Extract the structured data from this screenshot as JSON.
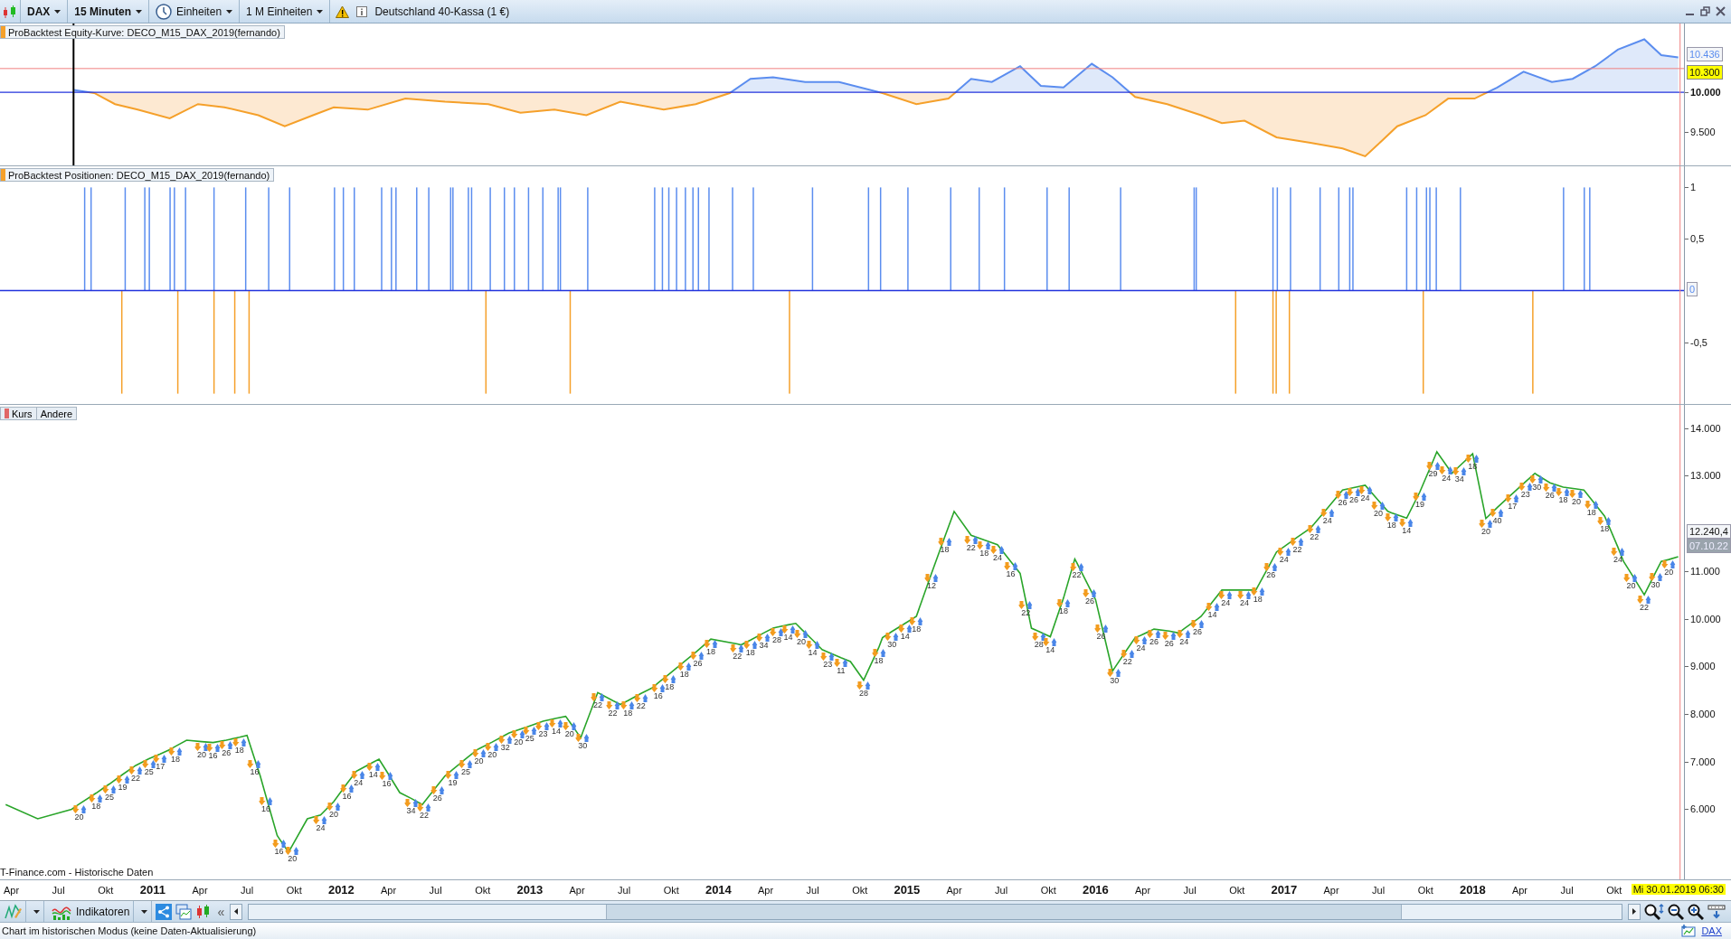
{
  "toolbar": {
    "symbol": "DAX",
    "timeframe": "15 Minuten",
    "units": "Einheiten",
    "units_count": "1 M Einheiten",
    "instrument": "Deutschland 40-Kassa (1 €)"
  },
  "equity_panel": {
    "legend": "ProBacktest Equity-Kurve: DECO_M15_DAX_2019(fernando)",
    "value_label": "10.436",
    "chart_data": {
      "type": "area",
      "xlim": [
        2010.19,
        2019.37
      ],
      "ylim": [
        9075,
        10870
      ],
      "yticks": [
        {
          "value": 10000,
          "label": "10.000"
        },
        {
          "value": 9500,
          "label": "9.500"
        }
      ],
      "x": [
        2010.58,
        2010.69,
        2010.8,
        2010.92,
        2011.09,
        2011.24,
        2011.38,
        2011.56,
        2011.7,
        2011.85,
        2011.96,
        2012.14,
        2012.34,
        2012.55,
        2012.78,
        2012.95,
        2013.13,
        2013.3,
        2013.48,
        2013.71,
        2013.88,
        2014.06,
        2014.17,
        2014.29,
        2014.46,
        2014.64,
        2014.87,
        2015.05,
        2015.22,
        2015.34,
        2015.45,
        2015.6,
        2015.71,
        2015.83,
        2015.98,
        2016.09,
        2016.21,
        2016.38,
        2016.56,
        2016.67,
        2016.79,
        2016.96,
        2017.14,
        2017.31,
        2017.43,
        2017.52,
        2017.6,
        2017.75,
        2017.87,
        2018.01,
        2018.13,
        2018.27,
        2018.42,
        2018.53,
        2018.65,
        2018.77,
        2018.91,
        2019.0,
        2019.09
      ],
      "series": [
        {
          "color": "#5b8def",
          "values": [
            10030,
            9990,
            9850,
            9780,
            9670,
            9850,
            9810,
            9710,
            9570,
            9710,
            9810,
            9780,
            9920,
            9880,
            9850,
            9740,
            9780,
            9710,
            9880,
            9780,
            9850,
            9990,
            10170,
            10190,
            10130,
            10130,
            9990,
            9850,
            9920,
            10170,
            10130,
            10330,
            10080,
            10060,
            10360,
            10190,
            9940,
            9850,
            9710,
            9610,
            9640,
            9430,
            9360,
            9290,
            9190,
            9390,
            9570,
            9710,
            9920,
            9920,
            10060,
            10260,
            10130,
            10170,
            10330,
            10540,
            10670,
            10470,
            10440
          ]
        }
      ],
      "ref_lines": [
        {
          "axis": "y",
          "value": 10000,
          "color": "#2233dd"
        },
        {
          "axis": "y",
          "value": 10300,
          "color": "#f08080",
          "label": "10.300"
        },
        {
          "axis": "x",
          "value": 2010.58,
          "color": "#000000"
        },
        {
          "axis": "x",
          "value": 2019.1,
          "color": "#f08080"
        }
      ]
    }
  },
  "positions_panel": {
    "legend": "ProBacktest Positionen: DECO_M15_DAX_2019(fernando)",
    "chart_data": {
      "type": "bar",
      "xlim": [
        2010.19,
        2019.37
      ],
      "ylim": [
        -1.1,
        1.205
      ],
      "yticks": [
        {
          "value": 1,
          "label": "1"
        },
        {
          "value": 0.5,
          "label": "0,5"
        },
        {
          "value": -0.5,
          "label": "-0,5"
        }
      ],
      "x": [
        2010.639,
        2010.673,
        2010.836,
        2010.854,
        2010.958,
        2010.982,
        2011.092,
        2011.115,
        2011.133,
        2011.174,
        2011.325,
        2011.435,
        2011.493,
        2011.511,
        2011.615,
        2011.726,
        2011.964,
        2012.011,
        2012.069,
        2012.214,
        2012.266,
        2012.29,
        2012.4,
        2012.464,
        2012.58,
        2012.592,
        2012.674,
        2012.691,
        2012.767,
        2012.79,
        2012.865,
        2012.918,
        2012.993,
        2013.069,
        2013.15,
        2013.162,
        2013.214,
        2013.307,
        2013.662,
        2013.703,
        2013.737,
        2013.778,
        2013.825,
        2013.865,
        2013.894,
        2013.95,
        2014.075,
        2014.185,
        2014.377,
        2014.499,
        2014.796,
        2014.86,
        2015.005,
        2015.232,
        2015.383,
        2015.517,
        2015.743,
        2015.86,
        2016.133,
        2016.523,
        2016.534,
        2016.743,
        2016.941,
        2016.958,
        2016.964,
        2017.028,
        2017.034,
        2017.191,
        2017.29,
        2017.348,
        2017.365,
        2017.65,
        2017.703,
        2017.738,
        2017.755,
        2017.773,
        2017.807,
        2017.935,
        2018.319,
        2018.482,
        2018.592,
        2018.621
      ],
      "series": [
        {
          "color": "#5b8def",
          "values": [
            1,
            1,
            null,
            1,
            1,
            1,
            1,
            1,
            null,
            1,
            1,
            null,
            1,
            null,
            1,
            1,
            1,
            1,
            1,
            1,
            1,
            1,
            1,
            1,
            1,
            1,
            1,
            1,
            null,
            1,
            1,
            1,
            1,
            1,
            1,
            1,
            null,
            1,
            1,
            1,
            1,
            1,
            1,
            1,
            1,
            1,
            1,
            1,
            null,
            1,
            1,
            1,
            1,
            1,
            1,
            1,
            1,
            1,
            1,
            1,
            1,
            null,
            1,
            null,
            1,
            null,
            1,
            1,
            1,
            1,
            1,
            1,
            1,
            null,
            1,
            1,
            1,
            1,
            null,
            1,
            1,
            1
          ]
        },
        {
          "color": "#f5a02a",
          "values": [
            null,
            null,
            -1,
            null,
            null,
            null,
            null,
            null,
            -1,
            null,
            -1,
            -1,
            null,
            -1,
            null,
            null,
            null,
            null,
            null,
            null,
            null,
            null,
            null,
            null,
            null,
            null,
            null,
            null,
            -1,
            null,
            null,
            null,
            null,
            null,
            null,
            null,
            -1,
            null,
            null,
            null,
            null,
            null,
            null,
            null,
            null,
            null,
            null,
            null,
            -1,
            null,
            null,
            null,
            null,
            null,
            null,
            null,
            null,
            null,
            null,
            null,
            null,
            -1,
            -1,
            -1,
            null,
            -1,
            null,
            null,
            null,
            null,
            null,
            null,
            null,
            -1,
            null,
            null,
            null,
            null,
            -1,
            null,
            null,
            null
          ]
        }
      ],
      "ref_lines": [
        {
          "axis": "y",
          "value": 0,
          "color": "#2233dd",
          "label": "0"
        },
        {
          "axis": "x",
          "value": 2019.1,
          "color": "#f08080"
        }
      ]
    }
  },
  "price_panel": {
    "tabs": [
      {
        "label": "Kurs",
        "color": "#e06666"
      },
      {
        "label": "Andere"
      }
    ],
    "source": "T-Finance.com - Historische Daten",
    "value_label": "12.240,4",
    "countdown": "07.10.22",
    "cursor_label": "Mi 30.01.2019 06:30",
    "chart_data": {
      "type": "line",
      "xlim": [
        2010.19,
        2019.37
      ],
      "ylim": [
        4530,
        14485
      ],
      "yticks": [
        {
          "value": 14000,
          "label": "14.000"
        },
        {
          "value": 13000,
          "label": "13.000"
        },
        {
          "value": 11000,
          "label": "11.000"
        },
        {
          "value": 10000,
          "label": "10.000"
        },
        {
          "value": 9000,
          "label": "9.000"
        },
        {
          "value": 8000,
          "label": "8.000"
        },
        {
          "value": 7000,
          "label": "7.000"
        },
        {
          "value": 6000,
          "label": "6.000"
        }
      ],
      "xticks": [
        {
          "value": 2010.25,
          "label": "Apr"
        },
        {
          "value": 2010.5,
          "label": "Jul"
        },
        {
          "value": 2010.75,
          "label": "Okt"
        },
        {
          "value": 2011,
          "label": "2011"
        },
        {
          "value": 2011.25,
          "label": "Apr"
        },
        {
          "value": 2011.5,
          "label": "Jul"
        },
        {
          "value": 2011.75,
          "label": "Okt"
        },
        {
          "value": 2012,
          "label": "2012"
        },
        {
          "value": 2012.25,
          "label": "Apr"
        },
        {
          "value": 2012.5,
          "label": "Jul"
        },
        {
          "value": 2012.75,
          "label": "Okt"
        },
        {
          "value": 2013,
          "label": "2013"
        },
        {
          "value": 2013.25,
          "label": "Apr"
        },
        {
          "value": 2013.5,
          "label": "Jul"
        },
        {
          "value": 2013.75,
          "label": "Okt"
        },
        {
          "value": 2014,
          "label": "2014"
        },
        {
          "value": 2014.25,
          "label": "Apr"
        },
        {
          "value": 2014.5,
          "label": "Jul"
        },
        {
          "value": 2014.75,
          "label": "Okt"
        },
        {
          "value": 2015,
          "label": "2015"
        },
        {
          "value": 2015.25,
          "label": "Apr"
        },
        {
          "value": 2015.5,
          "label": "Jul"
        },
        {
          "value": 2015.75,
          "label": "Okt"
        },
        {
          "value": 2016,
          "label": "2016"
        },
        {
          "value": 2016.25,
          "label": "Apr"
        },
        {
          "value": 2016.5,
          "label": "Jul"
        },
        {
          "value": 2016.75,
          "label": "Okt"
        },
        {
          "value": 2017,
          "label": "2017"
        },
        {
          "value": 2017.25,
          "label": "Apr"
        },
        {
          "value": 2017.5,
          "label": "Jul"
        },
        {
          "value": 2017.75,
          "label": "Okt"
        },
        {
          "value": 2018,
          "label": "2018"
        },
        {
          "value": 2018.25,
          "label": "Apr"
        },
        {
          "value": 2018.5,
          "label": "Jul"
        },
        {
          "value": 2018.75,
          "label": "Okt"
        }
      ],
      "x": [
        2010.22,
        2010.39,
        2010.57,
        2010.61,
        2010.7,
        2010.74,
        2010.77,
        2010.84,
        2010.91,
        2010.98,
        2011.04,
        2011.09,
        2011.12,
        2011.18,
        2011.26,
        2011.32,
        2011.39,
        2011.46,
        2011.5,
        2011.54,
        2011.57,
        2011.6,
        2011.66,
        2011.67,
        2011.72,
        2011.74,
        2011.82,
        2011.89,
        2011.96,
        2012.03,
        2012.08,
        2012.09,
        2012.17,
        2012.2,
        2012.24,
        2012.31,
        2012.37,
        2012.43,
        2012.44,
        2012.51,
        2012.55,
        2012.59,
        2012.66,
        2012.72,
        2012.73,
        2012.8,
        2012.87,
        2012.89,
        2012.94,
        2013.0,
        2013.07,
        2013.14,
        2013.19,
        2013.21,
        2013.27,
        2013.28,
        2013.36,
        2013.44,
        2013.48,
        2013.52,
        2013.59,
        2013.65,
        2013.68,
        2013.74,
        2013.82,
        2013.89,
        2013.96,
        2014.1,
        2014.12,
        2014.17,
        2014.24,
        2014.29,
        2014.31,
        2014.37,
        2014.41,
        2014.44,
        2014.5,
        2014.55,
        2014.58,
        2014.65,
        2014.7,
        2014.77,
        2014.85,
        2014.87,
        2014.92,
        2014.99,
        2015.05,
        2015.13,
        2015.2,
        2015.25,
        2015.34,
        2015.41,
        2015.48,
        2015.55,
        2015.6,
        2015.63,
        2015.66,
        2015.7,
        2015.76,
        2015.83,
        2015.89,
        2015.9,
        2015.97,
        2016.0,
        2016.03,
        2016.09,
        2016.1,
        2016.17,
        2016.21,
        2016.24,
        2016.31,
        2016.39,
        2016.44,
        2016.47,
        2016.54,
        2016.56,
        2016.62,
        2016.67,
        2016.69,
        2016.79,
        2016.85,
        2016.86,
        2016.93,
        2016.96,
        2017.0,
        2017.07,
        2017.14,
        2017.16,
        2017.23,
        2017.31,
        2017.37,
        2017.43,
        2017.5,
        2017.55,
        2017.57,
        2017.65,
        2017.72,
        2017.79,
        2017.81,
        2017.86,
        2017.89,
        2017.93,
        2018.0,
        2018.07,
        2018.13,
        2018.19,
        2018.21,
        2018.28,
        2018.33,
        2018.34,
        2018.41,
        2018.48,
        2018.55,
        2018.59,
        2018.63,
        2018.7,
        2018.77,
        2018.8,
        2018.84,
        2018.91,
        2018.97,
        2019.0,
        2019.04,
        2019.09
      ],
      "series": [
        {
          "color": "#2aa52a",
          "values": [
            6100,
            5800,
            6000,
            6110,
            6340,
            6450,
            6530,
            6730,
            6920,
            7060,
            7160,
            7250,
            7320,
            7450,
            7420,
            7400,
            7450,
            7510,
            7550,
            7060,
            6700,
            6280,
            5450,
            5390,
            5100,
            5240,
            5800,
            5880,
            6160,
            6540,
            6800,
            6820,
            6990,
            7050,
            6800,
            6350,
            6230,
            6100,
            6150,
            6500,
            6700,
            6830,
            7060,
            7250,
            7270,
            7410,
            7560,
            7600,
            7670,
            7750,
            7850,
            7910,
            7950,
            7840,
            7500,
            7610,
            8450,
            8280,
            8200,
            8280,
            8430,
            8550,
            8650,
            8840,
            9100,
            9330,
            9570,
            9470,
            9450,
            9550,
            9700,
            9800,
            9820,
            9870,
            9900,
            9780,
            9550,
            9350,
            9300,
            9180,
            9100,
            8710,
            9390,
            9600,
            9730,
            9900,
            10050,
            10950,
            11710,
            12250,
            11750,
            11650,
            11550,
            11200,
            10950,
            10380,
            9800,
            9730,
            9620,
            10430,
            11250,
            11180,
            10630,
            10400,
            9900,
            8900,
            8960,
            9370,
            9600,
            9650,
            9780,
            9740,
            9700,
            9790,
            9990,
            10050,
            10350,
            10600,
            10600,
            10600,
            10600,
            10670,
            11180,
            11400,
            11510,
            11710,
            11900,
            11990,
            12320,
            12700,
            12750,
            12800,
            12480,
            12250,
            12220,
            12110,
            12660,
            13310,
            13500,
            13220,
            13050,
            13200,
            13460,
            12100,
            12330,
            12550,
            12620,
            12870,
            13050,
            13020,
            12850,
            12760,
            12720,
            12700,
            12500,
            12150,
            11500,
            11200,
            10950,
            10500,
            10970,
            11200,
            11240,
            11300
          ]
        }
      ],
      "ref_lines": [
        {
          "axis": "x",
          "value": 2019.1,
          "color": "#f08080"
        }
      ],
      "annotations": [
        {
          "x": 2010.61,
          "y": 6110,
          "text": "20"
        },
        {
          "x": 2010.7,
          "y": 6340,
          "text": "18"
        },
        {
          "x": 2010.77,
          "y": 6530,
          "text": "25"
        },
        {
          "x": 2010.84,
          "y": 6730,
          "text": "19"
        },
        {
          "x": 2010.91,
          "y": 6920,
          "text": "22"
        },
        {
          "x": 2010.98,
          "y": 7060,
          "text": "25"
        },
        {
          "x": 2011.04,
          "y": 7160,
          "text": "17"
        },
        {
          "x": 2011.12,
          "y": 7320,
          "text": "18"
        },
        {
          "x": 2011.26,
          "y": 7420,
          "text": "20"
        },
        {
          "x": 2011.32,
          "y": 7400,
          "text": "16"
        },
        {
          "x": 2011.39,
          "y": 7450,
          "text": "26"
        },
        {
          "x": 2011.46,
          "y": 7510,
          "text": "18"
        },
        {
          "x": 2011.54,
          "y": 7060,
          "text": "16"
        },
        {
          "x": 2011.6,
          "y": 6280,
          "text": "16"
        },
        {
          "x": 2011.67,
          "y": 5390,
          "text": "16"
        },
        {
          "x": 2011.74,
          "y": 5240,
          "text": "20"
        },
        {
          "x": 2011.89,
          "y": 5880,
          "text": "24"
        },
        {
          "x": 2011.96,
          "y": 6160,
          "text": "20"
        },
        {
          "x": 2012.03,
          "y": 6540,
          "text": "16"
        },
        {
          "x": 2012.09,
          "y": 6820,
          "text": "24"
        },
        {
          "x": 2012.17,
          "y": 6990,
          "text": "14"
        },
        {
          "x": 2012.24,
          "y": 6800,
          "text": "16"
        },
        {
          "x": 2012.37,
          "y": 6230,
          "text": "34"
        },
        {
          "x": 2012.44,
          "y": 6150,
          "text": "22"
        },
        {
          "x": 2012.51,
          "y": 6500,
          "text": "26"
        },
        {
          "x": 2012.59,
          "y": 6830,
          "text": "19"
        },
        {
          "x": 2012.66,
          "y": 7060,
          "text": "25"
        },
        {
          "x": 2012.73,
          "y": 7270,
          "text": "20"
        },
        {
          "x": 2012.8,
          "y": 7410,
          "text": "20"
        },
        {
          "x": 2012.87,
          "y": 7560,
          "text": "32"
        },
        {
          "x": 2012.94,
          "y": 7670,
          "text": "20"
        },
        {
          "x": 2013.0,
          "y": 7750,
          "text": "25"
        },
        {
          "x": 2013.07,
          "y": 7850,
          "text": "23"
        },
        {
          "x": 2013.14,
          "y": 7910,
          "text": "14"
        },
        {
          "x": 2013.21,
          "y": 7840,
          "text": "20"
        },
        {
          "x": 2013.28,
          "y": 7610,
          "text": "30"
        },
        {
          "x": 2013.36,
          "y": 8450,
          "text": "22"
        },
        {
          "x": 2013.44,
          "y": 8280,
          "text": "22"
        },
        {
          "x": 2013.52,
          "y": 8280,
          "text": "18"
        },
        {
          "x": 2013.59,
          "y": 8430,
          "text": "22"
        },
        {
          "x": 2013.68,
          "y": 8650,
          "text": "16"
        },
        {
          "x": 2013.74,
          "y": 8840,
          "text": "18"
        },
        {
          "x": 2013.82,
          "y": 9100,
          "text": "18"
        },
        {
          "x": 2013.89,
          "y": 9330,
          "text": "26"
        },
        {
          "x": 2013.96,
          "y": 9570,
          "text": "18"
        },
        {
          "x": 2014.1,
          "y": 9470,
          "text": "22"
        },
        {
          "x": 2014.17,
          "y": 9550,
          "text": "18"
        },
        {
          "x": 2014.24,
          "y": 9700,
          "text": "34"
        },
        {
          "x": 2014.31,
          "y": 9820,
          "text": "28"
        },
        {
          "x": 2014.37,
          "y": 9870,
          "text": "14"
        },
        {
          "x": 2014.44,
          "y": 9780,
          "text": "20"
        },
        {
          "x": 2014.5,
          "y": 9550,
          "text": "14"
        },
        {
          "x": 2014.58,
          "y": 9300,
          "text": "23"
        },
        {
          "x": 2014.65,
          "y": 9180,
          "text": "11"
        },
        {
          "x": 2014.77,
          "y": 8710,
          "text": "28"
        },
        {
          "x": 2014.85,
          "y": 9390,
          "text": "18"
        },
        {
          "x": 2014.92,
          "y": 9730,
          "text": "30"
        },
        {
          "x": 2014.99,
          "y": 9900,
          "text": "14"
        },
        {
          "x": 2015.05,
          "y": 10050,
          "text": "18"
        },
        {
          "x": 2015.13,
          "y": 10950,
          "text": "12"
        },
        {
          "x": 2015.2,
          "y": 11710,
          "text": "18"
        },
        {
          "x": 2015.34,
          "y": 11750,
          "text": "22"
        },
        {
          "x": 2015.41,
          "y": 11650,
          "text": "18"
        },
        {
          "x": 2015.48,
          "y": 11550,
          "text": "24"
        },
        {
          "x": 2015.55,
          "y": 11200,
          "text": "16"
        },
        {
          "x": 2015.63,
          "y": 10380,
          "text": "22"
        },
        {
          "x": 2015.7,
          "y": 9730,
          "text": "28"
        },
        {
          "x": 2015.76,
          "y": 9620,
          "text": "14"
        },
        {
          "x": 2015.83,
          "y": 10430,
          "text": "18"
        },
        {
          "x": 2015.9,
          "y": 11180,
          "text": "22"
        },
        {
          "x": 2015.97,
          "y": 10630,
          "text": "26"
        },
        {
          "x": 2016.03,
          "y": 9900,
          "text": "26"
        },
        {
          "x": 2016.1,
          "y": 8960,
          "text": "30"
        },
        {
          "x": 2016.17,
          "y": 9370,
          "text": "22"
        },
        {
          "x": 2016.24,
          "y": 9650,
          "text": "24"
        },
        {
          "x": 2016.31,
          "y": 9780,
          "text": "26"
        },
        {
          "x": 2016.39,
          "y": 9740,
          "text": "26"
        },
        {
          "x": 2016.47,
          "y": 9790,
          "text": "24"
        },
        {
          "x": 2016.54,
          "y": 9990,
          "text": "26"
        },
        {
          "x": 2016.62,
          "y": 10350,
          "text": "14"
        },
        {
          "x": 2016.69,
          "y": 10600,
          "text": "24"
        },
        {
          "x": 2016.79,
          "y": 10600,
          "text": "24"
        },
        {
          "x": 2016.86,
          "y": 10670,
          "text": "18"
        },
        {
          "x": 2016.93,
          "y": 11180,
          "text": "26"
        },
        {
          "x": 2017.0,
          "y": 11510,
          "text": "24"
        },
        {
          "x": 2017.07,
          "y": 11710,
          "text": "22"
        },
        {
          "x": 2017.16,
          "y": 11990,
          "text": "22"
        },
        {
          "x": 2017.23,
          "y": 12320,
          "text": "24"
        },
        {
          "x": 2017.31,
          "y": 12700,
          "text": "26"
        },
        {
          "x": 2017.37,
          "y": 12750,
          "text": "26"
        },
        {
          "x": 2017.43,
          "y": 12800,
          "text": "24"
        },
        {
          "x": 2017.5,
          "y": 12480,
          "text": "20"
        },
        {
          "x": 2017.57,
          "y": 12220,
          "text": "18"
        },
        {
          "x": 2017.65,
          "y": 12110,
          "text": "14"
        },
        {
          "x": 2017.72,
          "y": 12660,
          "text": "19"
        },
        {
          "x": 2017.79,
          "y": 13310,
          "text": "29"
        },
        {
          "x": 2017.86,
          "y": 13220,
          "text": "24"
        },
        {
          "x": 2017.93,
          "y": 13200,
          "text": "34"
        },
        {
          "x": 2018.0,
          "y": 13460,
          "text": "18"
        },
        {
          "x": 2018.07,
          "y": 12100,
          "text": "20"
        },
        {
          "x": 2018.13,
          "y": 12330,
          "text": "40"
        },
        {
          "x": 2018.21,
          "y": 12620,
          "text": "17"
        },
        {
          "x": 2018.28,
          "y": 12870,
          "text": "23"
        },
        {
          "x": 2018.34,
          "y": 13020,
          "text": "30"
        },
        {
          "x": 2018.41,
          "y": 12850,
          "text": "26"
        },
        {
          "x": 2018.48,
          "y": 12760,
          "text": "18"
        },
        {
          "x": 2018.55,
          "y": 12720,
          "text": "20"
        },
        {
          "x": 2018.63,
          "y": 12500,
          "text": "18"
        },
        {
          "x": 2018.7,
          "y": 12150,
          "text": "18"
        },
        {
          "x": 2018.77,
          "y": 11500,
          "text": "24"
        },
        {
          "x": 2018.84,
          "y": 10950,
          "text": "20"
        },
        {
          "x": 2018.91,
          "y": 10500,
          "text": "22"
        },
        {
          "x": 2018.97,
          "y": 10970,
          "text": "30"
        },
        {
          "x": 2019.04,
          "y": 11240,
          "text": "20"
        }
      ]
    }
  },
  "bottom_toolbar": {
    "indicators_button": "Indikatoren",
    "collapse": "«"
  },
  "status_bar": {
    "message": "Chart im historischen Modus (keine Daten-Aktualisierung)",
    "symbol_link": "DAX"
  }
}
